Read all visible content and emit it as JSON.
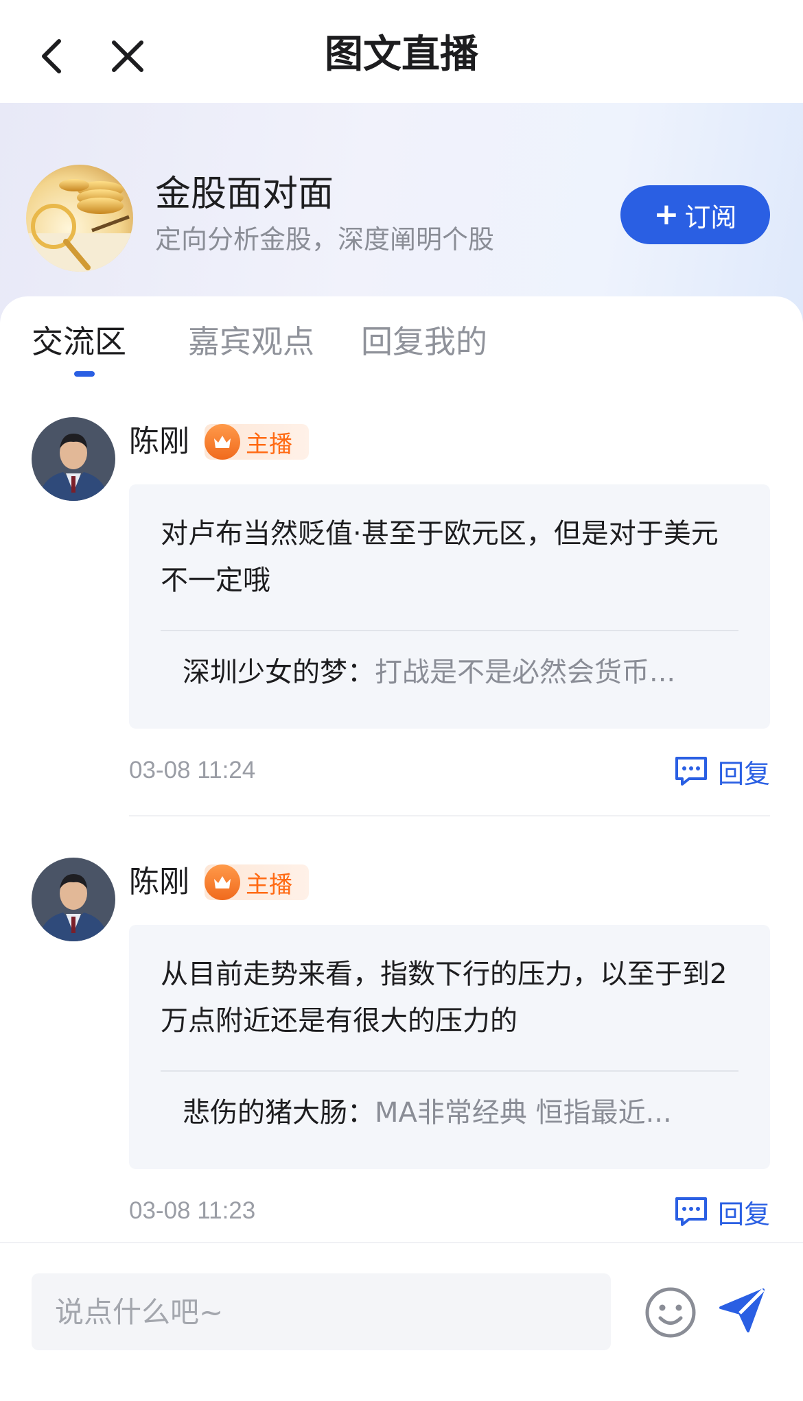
{
  "nav": {
    "title": "图文直播"
  },
  "channel": {
    "name": "金股面对面",
    "description": "定向分析金股，深度阐明个股",
    "subscribe_label": "订阅"
  },
  "tabs": [
    {
      "label": "交流区",
      "active": true
    },
    {
      "label": "嘉宾观点",
      "active": false
    },
    {
      "label": "回复我的",
      "active": false
    }
  ],
  "messages": [
    {
      "author": "陈刚",
      "badge": "主播",
      "text": "对卢布当然贬值·甚至于欧元区，但是对于美元不一定哦",
      "quote_author": "深圳少女的梦：",
      "quote_text": "打战是不是必然会货币...",
      "time": "03-08 11:24",
      "reply_label": "回复"
    },
    {
      "author": "陈刚",
      "badge": "主播",
      "text": "从目前走势来看，指数下行的压力，以至于到2万点附近还是有很大的压力的",
      "quote_author": "悲伤的猪大肠：",
      "quote_text": "MA非常经典 恒指最近...",
      "time": "03-08 11:23",
      "reply_label": "回复"
    }
  ],
  "input": {
    "placeholder": "说点什么吧~"
  },
  "colors": {
    "accent": "#2a5fe3",
    "badge": "#ff6a13"
  }
}
